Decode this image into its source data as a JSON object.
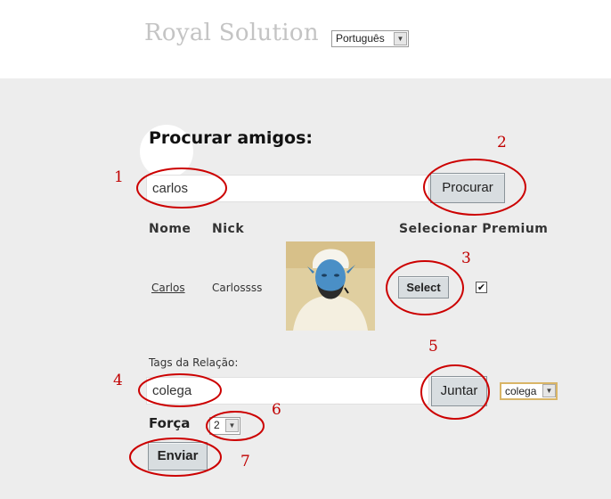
{
  "header": {
    "brand": "Royal Solution",
    "language_select": {
      "value": "Português",
      "arrow_icon": "chevron-down-icon"
    }
  },
  "search": {
    "title": "Procurar amigos:",
    "input_value": "carlos",
    "button_label": "Procurar"
  },
  "results": {
    "columns": [
      "Nome",
      "Nick",
      "Selecionar Premium"
    ],
    "rows": [
      {
        "name": "Carlos",
        "nick": "Carlossss",
        "select_label": "Select",
        "premium_checked": true,
        "checkbox_mark": "✔"
      }
    ]
  },
  "relation": {
    "tags_label": "Tags da Relação:",
    "tags_input_value": "colega",
    "join_label": "Juntar",
    "tag_select_value": "colega",
    "strength_label": "Força",
    "strength_value": "2",
    "send_label": "Enviar"
  },
  "annotations": [
    "1",
    "2",
    "3",
    "4",
    "5",
    "6",
    "7"
  ],
  "colors": {
    "annotation": "#cc0000",
    "page_background": "#ededed",
    "button_fill": "#d8dde0",
    "brand_text": "#c4c4c4"
  }
}
